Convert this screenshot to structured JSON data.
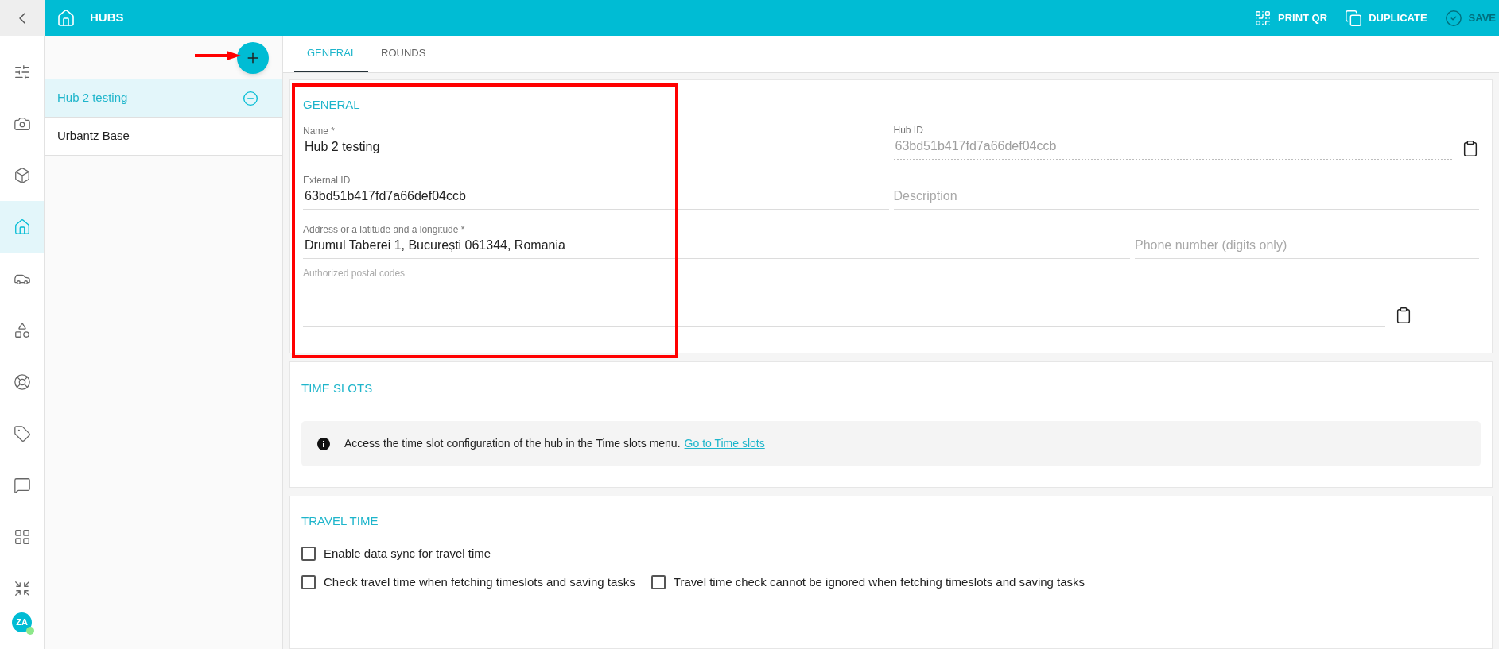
{
  "header": {
    "title": "HUBS",
    "actions": [
      {
        "kind": "qr",
        "label": "PRINT QR",
        "disabled": false
      },
      {
        "kind": "duplicate",
        "label": "DUPLICATE",
        "disabled": false
      },
      {
        "kind": "save",
        "label": "SAVE",
        "disabled": true
      }
    ]
  },
  "nav": {
    "items": [
      {
        "kind": "sliders",
        "selected": false
      },
      {
        "kind": "camera",
        "selected": false
      },
      {
        "kind": "cube",
        "selected": false
      },
      {
        "kind": "home",
        "selected": true
      },
      {
        "kind": "car",
        "selected": false
      },
      {
        "kind": "shapes",
        "selected": false
      },
      {
        "kind": "wheel",
        "selected": false
      },
      {
        "kind": "tag",
        "selected": false
      },
      {
        "kind": "chat",
        "selected": false
      },
      {
        "kind": "grid",
        "selected": false
      },
      {
        "kind": "shrink",
        "selected": false
      }
    ],
    "avatar": {
      "initials": "ZA",
      "online": true
    }
  },
  "hub_list": {
    "items": [
      {
        "name": "Hub 2 testing",
        "selected": true
      },
      {
        "name": "Urbantz Base",
        "selected": false
      }
    ]
  },
  "tabs": [
    {
      "label": "GENERAL",
      "selected": true
    },
    {
      "label": "ROUNDS",
      "selected": false
    }
  ],
  "general": {
    "title": "GENERAL",
    "rows": [
      [
        {
          "label": "Name *",
          "value": "Hub 2 testing",
          "disabled": false,
          "copyable": false
        },
        {
          "label": "Hub ID",
          "value": "63bd51b417fd7a66def04ccb",
          "disabled": true,
          "copyable": true
        }
      ],
      [
        {
          "label": "External ID",
          "value": "63bd51b417fd7a66def04ccb",
          "disabled": false,
          "copyable": false
        },
        {
          "placeholder": "Description",
          "disabled": false,
          "copyable": false
        }
      ],
      [
        {
          "label": "Address or a latitude and a longitude *",
          "value": "Drumul Taberei 1, București 061344, Romania",
          "disabled": false,
          "copyable": false
        },
        {
          "placeholder": "Phone number (digits only)",
          "disabled": false,
          "copyable": false
        }
      ],
      [
        {
          "label": "Authorized postal codes",
          "disabled": false,
          "copyable": true
        }
      ]
    ]
  },
  "time_slots": {
    "title": "TIME SLOTS",
    "message": "Access the time slot configuration of the hub in the Time slots menu.",
    "link": "Go to Time slots"
  },
  "travel_time": {
    "title": "TRAVEL TIME",
    "rows": [
      [
        {
          "label": "Enable data sync for travel time",
          "checked": false
        }
      ],
      [
        {
          "label": "Check travel time when fetching timeslots and saving tasks",
          "checked": false
        },
        {
          "label": "Travel time check cannot be ignored when fetching timeslots and saving tasks",
          "checked": false
        }
      ]
    ]
  }
}
